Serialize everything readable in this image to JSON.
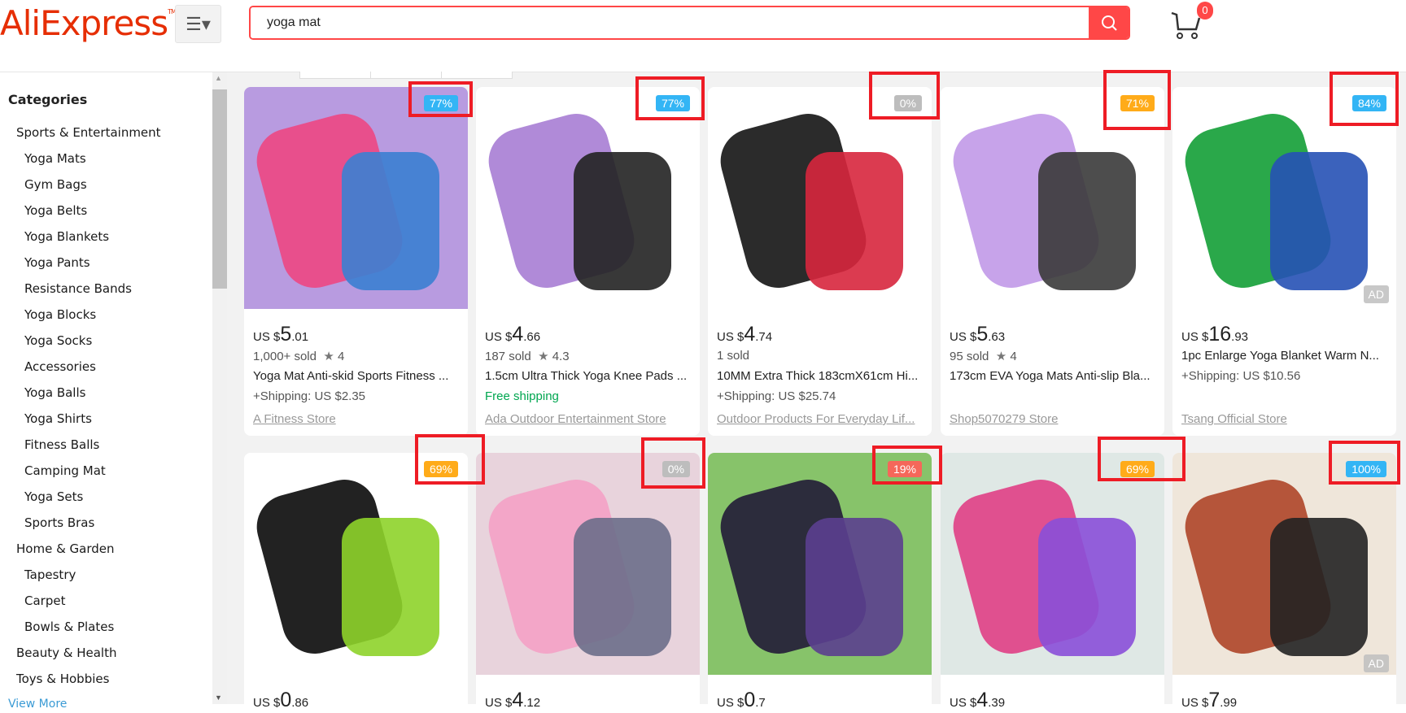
{
  "header": {
    "logo": "AliExpress",
    "search_value": "yoga mat",
    "cart_count": "0"
  },
  "sidebar": {
    "title": "Categories",
    "items": [
      {
        "label": "Sports & Entertainment",
        "level": 0
      },
      {
        "label": "Yoga Mats",
        "level": 1
      },
      {
        "label": "Gym Bags",
        "level": 1
      },
      {
        "label": "Yoga Belts",
        "level": 1
      },
      {
        "label": "Yoga Blankets",
        "level": 1
      },
      {
        "label": "Yoga Pants",
        "level": 1
      },
      {
        "label": "Resistance Bands",
        "level": 1
      },
      {
        "label": "Yoga Blocks",
        "level": 1
      },
      {
        "label": "Yoga Socks",
        "level": 1
      },
      {
        "label": "Accessories",
        "level": 1
      },
      {
        "label": "Yoga Balls",
        "level": 1
      },
      {
        "label": "Yoga Shirts",
        "level": 1
      },
      {
        "label": "Fitness Balls",
        "level": 1
      },
      {
        "label": "Camping Mat",
        "level": 1
      },
      {
        "label": "Yoga Sets",
        "level": 1
      },
      {
        "label": "Sports Bras",
        "level": 1
      },
      {
        "label": "Home & Garden",
        "level": 0
      },
      {
        "label": "Tapestry",
        "level": 1
      },
      {
        "label": "Carpet",
        "level": 1
      },
      {
        "label": "Bowls & Plates",
        "level": 1
      },
      {
        "label": "Beauty & Health",
        "level": 0
      },
      {
        "label": "Toys & Hobbies",
        "level": 0
      }
    ],
    "view_more": "View More"
  },
  "colors": {
    "blue": "#33b5f5",
    "gray": "#bdbdbd",
    "orange": "#ffab19",
    "red": "#f5675a"
  },
  "products": [
    {
      "discount": "77%",
      "badge": "blue",
      "currency": "US $",
      "int": "5",
      "dec": ".01",
      "sold": "1,000+ sold",
      "rating": "4",
      "title": "Yoga Mat Anti-skid Sports Fitness ...",
      "shipping": "+Shipping: US $2.35",
      "store": "A Fitness Store",
      "img": [
        "#b89be0",
        "#e84f8c",
        "#3b7fd1"
      ]
    },
    {
      "discount": "77%",
      "badge": "blue",
      "currency": "US $",
      "int": "4",
      "dec": ".66",
      "sold": "187 sold",
      "rating": "4.3",
      "title": "1.5cm Ultra Thick Yoga Knee Pads ...",
      "shipping": "Free shipping",
      "free": true,
      "store": "Ada Outdoor Entertainment Store",
      "img": [
        "#fff",
        "#b08ad8",
        "#222"
      ]
    },
    {
      "discount": "0%",
      "badge": "gray",
      "currency": "US $",
      "int": "4",
      "dec": ".74",
      "sold": "1 sold",
      "title": "10MM Extra Thick 183cmX61cm Hi...",
      "shipping": "+Shipping: US $25.74",
      "store": "Outdoor Products For Everyday Lif...",
      "img": [
        "#fff",
        "#2b2b2b",
        "#d7263d"
      ]
    },
    {
      "discount": "71%",
      "badge": "orange",
      "currency": "US $",
      "int": "5",
      "dec": ".63",
      "sold": "95 sold",
      "rating": "4",
      "title": "173cm EVA Yoga Mats Anti-slip Bla...",
      "store": "Shop5070279 Store",
      "img": [
        "#fff",
        "#c7a3ea",
        "#3a3a3a"
      ]
    },
    {
      "discount": "84%",
      "badge": "blue",
      "currency": "US $",
      "int": "16",
      "dec": ".93",
      "title": "1pc Enlarge Yoga Blanket Warm N...",
      "shipping": "+Shipping: US $10.56",
      "store": "Tsang Official Store",
      "ad": "AD",
      "noSold": true,
      "img": [
        "#fff",
        "#2aa84a",
        "#2651b5"
      ]
    },
    {
      "discount": "69%",
      "badge": "orange",
      "currency": "US $",
      "int": "0",
      "dec": ".86",
      "img": [
        "#fff",
        "#222",
        "#8ed32a"
      ]
    },
    {
      "discount": "0%",
      "badge": "gray",
      "currency": "US $",
      "int": "4",
      "dec": ".12",
      "img": [
        "#e8d3dc",
        "#f3a6c8",
        "#6b6e8a"
      ]
    },
    {
      "discount": "19%",
      "badge": "red",
      "currency": "US $",
      "int": "0",
      "dec": ".7",
      "img": [
        "#87c36a",
        "#2c2c3c",
        "#5b3f8f"
      ]
    },
    {
      "discount": "69%",
      "badge": "orange",
      "currency": "US $",
      "int": "4",
      "dec": ".39",
      "img": [
        "#dfe8e5",
        "#e0508f",
        "#8a4fd8"
      ]
    },
    {
      "discount": "100%",
      "badge": "blue",
      "currency": "US $",
      "int": "7",
      "dec": ".99",
      "ad": "AD",
      "img": [
        "#efe6da",
        "#b5553a",
        "#222"
      ]
    }
  ]
}
